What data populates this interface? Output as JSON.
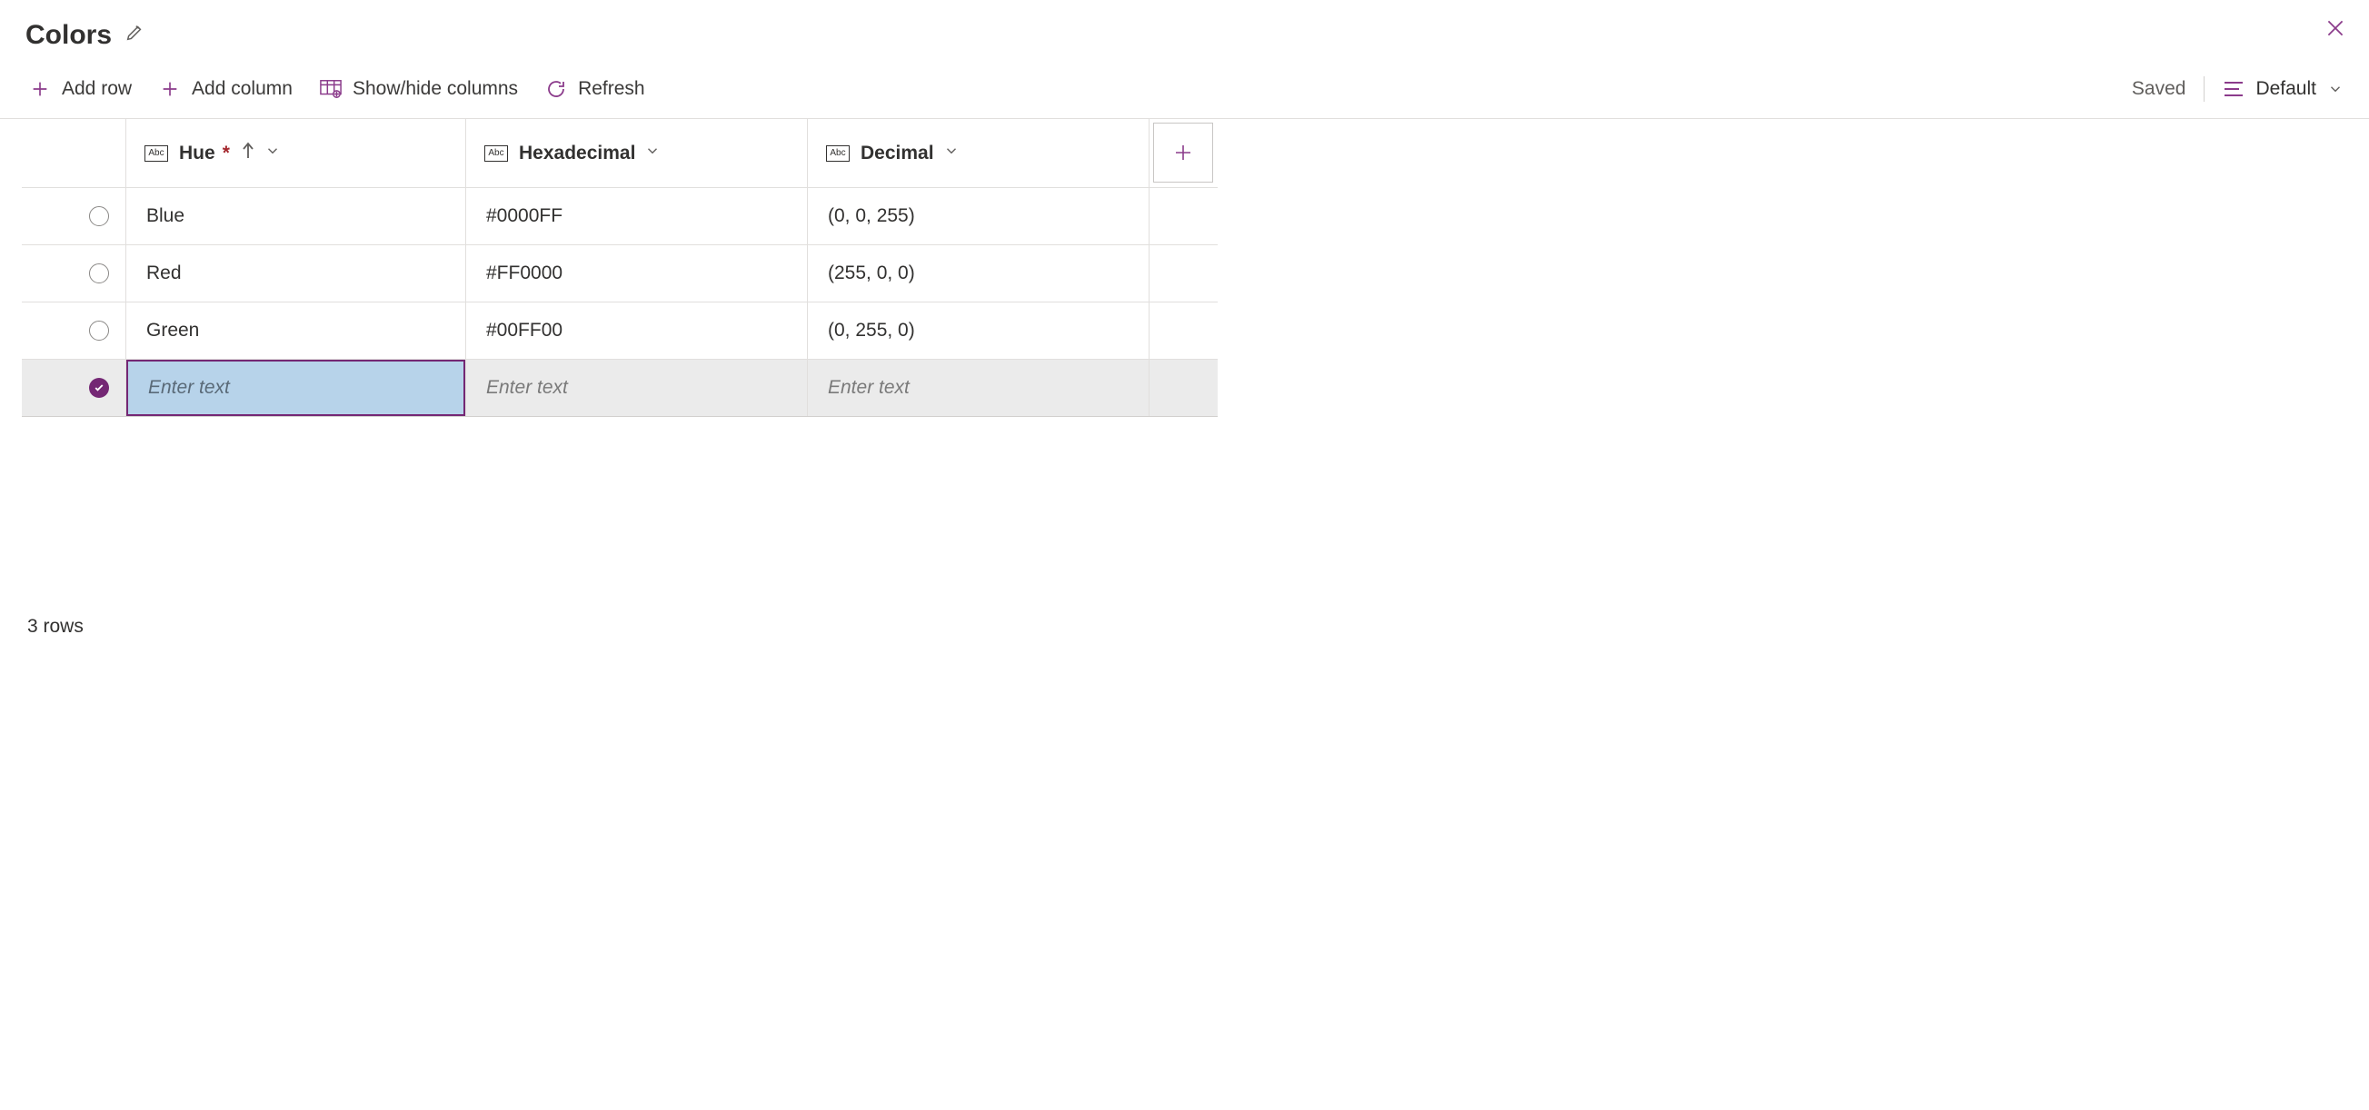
{
  "header": {
    "title": "Colors"
  },
  "toolbar": {
    "add_row": "Add row",
    "add_column": "Add column",
    "show_hide": "Show/hide columns",
    "refresh": "Refresh",
    "saved": "Saved",
    "view": "Default"
  },
  "columns": {
    "hue": {
      "label": "Hue",
      "type_badge": "Abc",
      "required": "*"
    },
    "hex": {
      "label": "Hexadecimal",
      "type_badge": "Abc"
    },
    "dec": {
      "label": "Decimal",
      "type_badge": "Abc"
    }
  },
  "rows": [
    {
      "hue": "Blue",
      "hex": "#0000FF",
      "dec": "(0, 0, 255)"
    },
    {
      "hue": "Red",
      "hex": "#FF0000",
      "dec": "(255, 0, 0)"
    },
    {
      "hue": "Green",
      "hex": "#00FF00",
      "dec": "(0, 255, 0)"
    }
  ],
  "new_row": {
    "placeholder": "Enter text"
  },
  "footer": {
    "row_count": "3 rows"
  }
}
